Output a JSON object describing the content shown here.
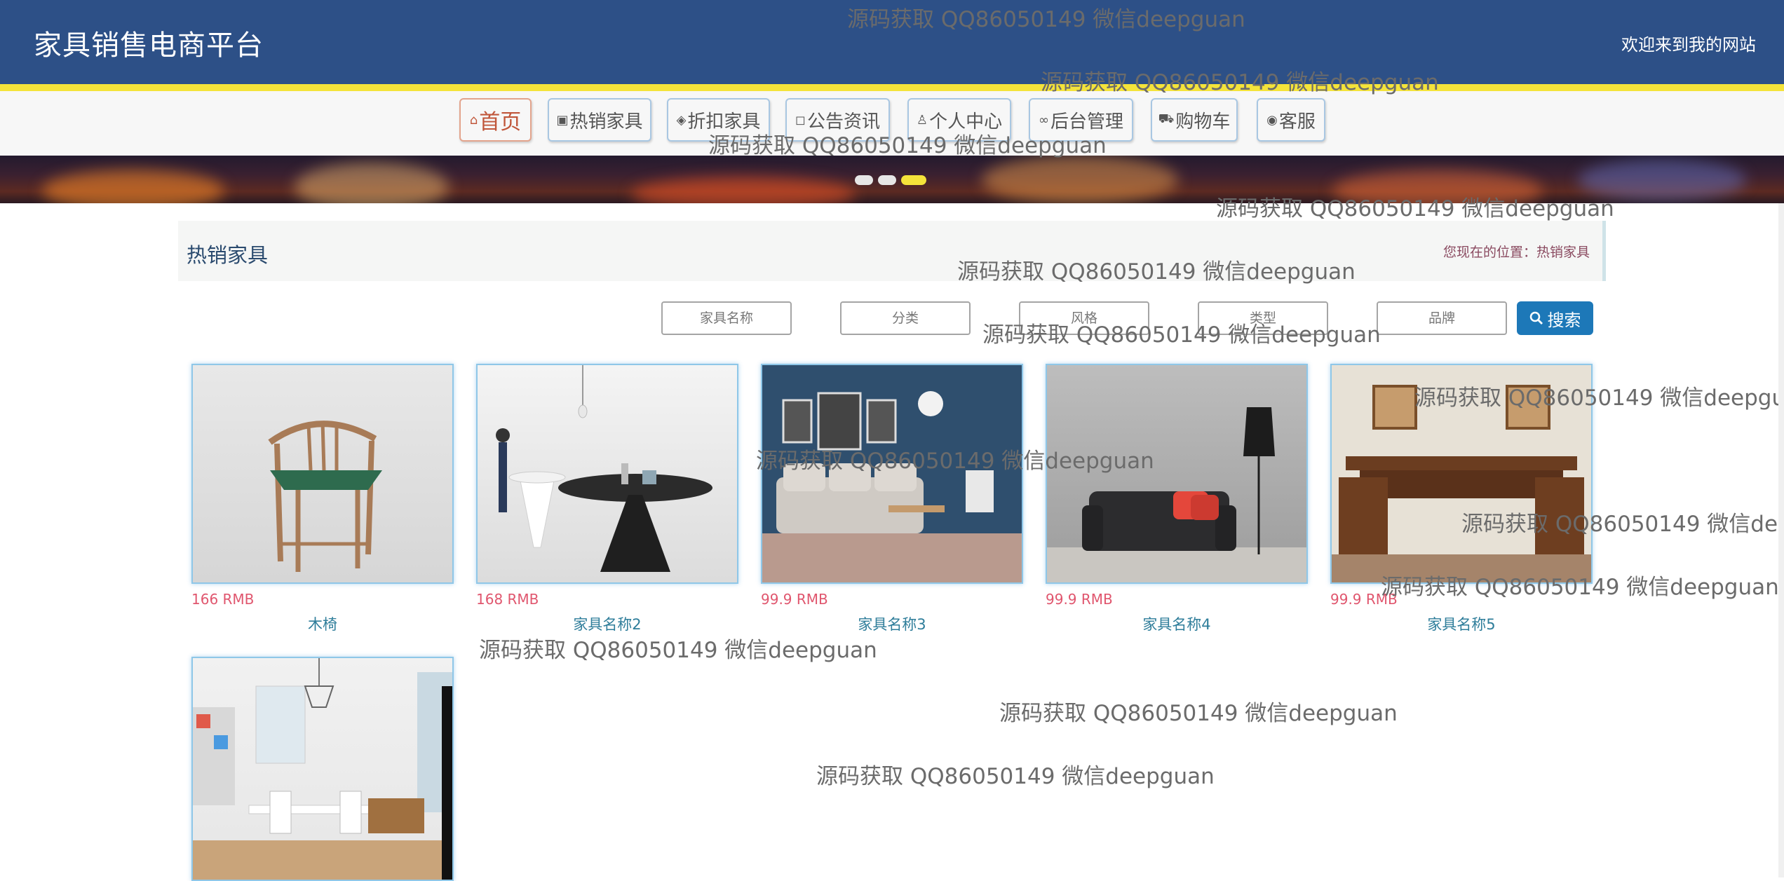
{
  "header": {
    "site_title": "家具销售电商平台",
    "welcome": "欢迎来到我的网站"
  },
  "nav": [
    {
      "label": "首页",
      "icon": "home-icon",
      "glyph": "⌂"
    },
    {
      "label": "热销家具",
      "icon": "gift-icon",
      "glyph": "▣"
    },
    {
      "label": "折扣家具",
      "icon": "layers-icon",
      "glyph": "◈"
    },
    {
      "label": "公告资讯",
      "icon": "note-icon",
      "glyph": "◻"
    },
    {
      "label": "个人中心",
      "icon": "user-icon",
      "glyph": "♙"
    },
    {
      "label": "后台管理",
      "icon": "link-icon",
      "glyph": "∞"
    },
    {
      "label": "购物车",
      "icon": "cart-icon",
      "glyph": "⛟"
    },
    {
      "label": "客服",
      "icon": "chat-icon",
      "glyph": "◉"
    }
  ],
  "banner": {
    "active_slide": 3,
    "slide_count": 3
  },
  "breadcrumb": {
    "title": "热销家具",
    "location": "您现在的位置：热销家具"
  },
  "search": {
    "name_placeholder": "家具名称",
    "category_placeholder": "分类",
    "style_placeholder": "风格",
    "type_placeholder": "类型",
    "brand_placeholder": "品牌",
    "button_label": "搜索"
  },
  "products": [
    {
      "price": "166 RMB",
      "name": "木椅"
    },
    {
      "price": "168 RMB",
      "name": "家具名称2"
    },
    {
      "price": "99.9 RMB",
      "name": "家具名称3"
    },
    {
      "price": "99.9 RMB",
      "name": "家具名称4"
    },
    {
      "price": "99.9 RMB",
      "name": "家具名称5"
    },
    {
      "price": "",
      "name": ""
    }
  ],
  "watermark": "源码获取 QQ86050149 微信deepguan",
  "colors": {
    "header_bg": "#2d5087",
    "header_stripe": "#f4e33a",
    "price": "#e0566e",
    "name": "#2e7d9a",
    "search_button": "#1d78b8"
  }
}
